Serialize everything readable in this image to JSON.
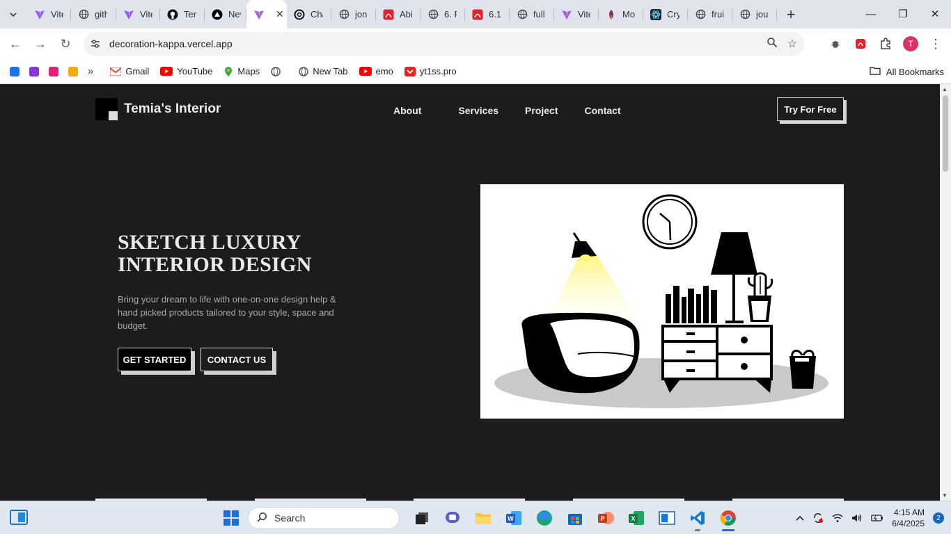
{
  "browser": {
    "tabs": [
      {
        "title": "Vite",
        "icon": "vite-icon"
      },
      {
        "title": "gith",
        "icon": "globe-icon"
      },
      {
        "title": "Vite",
        "icon": "vite-icon"
      },
      {
        "title": "Ten",
        "icon": "github-icon"
      },
      {
        "title": "Nev",
        "icon": "vercel-icon"
      },
      {
        "title": "",
        "icon": "vite-icon",
        "active": true
      },
      {
        "title": "Cha",
        "icon": "openai-icon"
      },
      {
        "title": "jon",
        "icon": "globe-icon"
      },
      {
        "title": "Abi",
        "icon": "pdf-icon"
      },
      {
        "title": "6. F",
        "icon": "globe-icon"
      },
      {
        "title": "6.1",
        "icon": "pdf-icon"
      },
      {
        "title": "full",
        "icon": "globe-icon"
      },
      {
        "title": "Vite",
        "icon": "vite-icon"
      },
      {
        "title": "Mo",
        "icon": "mongo-icon"
      },
      {
        "title": "Cry",
        "icon": "react-icon"
      },
      {
        "title": "frui",
        "icon": "globe-icon"
      },
      {
        "title": "jou",
        "icon": "globe-icon"
      }
    ],
    "url": "decoration-kappa.vercel.app",
    "bookmarks": [
      {
        "label": "Gmail"
      },
      {
        "label": "YouTube"
      },
      {
        "label": "Maps"
      },
      {
        "label": "New Tab"
      },
      {
        "label": "emo"
      },
      {
        "label": "yt1ss.pro"
      }
    ],
    "all_bookmarks": "All Bookmarks",
    "profile_initial": "T"
  },
  "site": {
    "brand": "Temia's Interior",
    "nav": [
      "About",
      "Services",
      "Project",
      "Contact"
    ],
    "cta": "Try For Free",
    "hero": {
      "title_line1": "SKETCH LUXURY",
      "title_line2": "INTERIOR DESIGN",
      "description": "Bring your dream to life with one-on-one design help & hand picked products tailored to your style, space and budget.",
      "primary_button": "GET STARTED",
      "secondary_button": "CONTACT US"
    }
  },
  "taskbar": {
    "search_placeholder": "Search",
    "time": "4:15 AM",
    "date": "6/4/2025",
    "notifications": "2"
  },
  "colors": {
    "page_bg": "#1c1c1e",
    "lamp_glow": "#fff475",
    "accent_avatar": "#d93465"
  }
}
